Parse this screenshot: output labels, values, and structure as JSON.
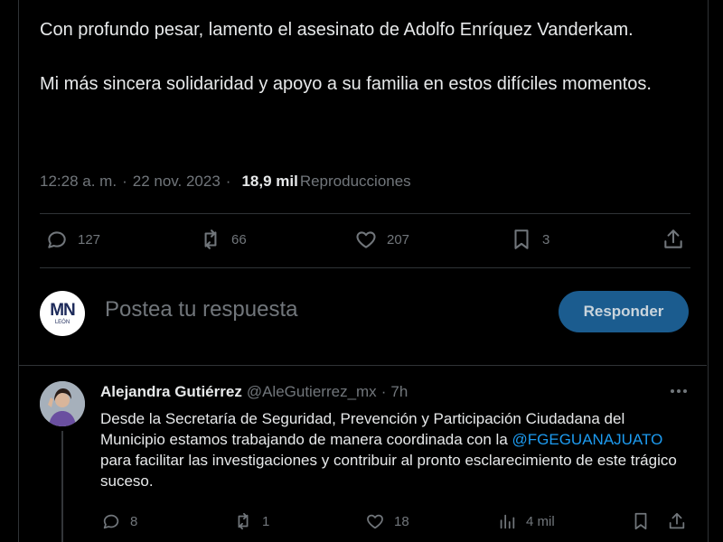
{
  "tweet": {
    "paragraph1": "Con profundo pesar, lamento el asesinato de Adolfo Enríquez Vanderkam.",
    "paragraph2": "Mi más sincera solidaridad y apoyo a su familia en estos difíciles momentos.",
    "time": "12:28 a. m.",
    "date": "22 nov. 2023",
    "views_count": "18,9 mil",
    "views_label": "Reproducciones",
    "separator": "·",
    "stats": {
      "replies": "127",
      "reposts": "66",
      "likes": "207",
      "bookmarks": "3"
    }
  },
  "composer": {
    "placeholder": "Postea tu respuesta",
    "button_label": "Responder",
    "avatar_text": "MN",
    "avatar_sub": "LEÓN"
  },
  "reply": {
    "name": "Alejandra Gutiérrez",
    "handle": "@AleGutierrez_mx",
    "age": "7h",
    "text_before": "Desde la Secretaría de Seguridad, Prevención y Participación Ciudadana del Municipio estamos trabajando de manera coordinada con la ",
    "mention": "@FGEGUANAJUATO",
    "text_after": " para facilitar las investigaciones y contribuir al pronto esclarecimiento de este trágico suceso.",
    "stats": {
      "replies": "8",
      "reposts": "1",
      "likes": "18",
      "views": "4 mil"
    }
  },
  "colors": {
    "background": "#000000",
    "text": "#e7e9ea",
    "muted": "#71767b",
    "accent": "#1d9bf0",
    "button": "#1b5c8f"
  },
  "icons": [
    "reply-icon",
    "repost-icon",
    "like-icon",
    "bookmark-icon",
    "share-icon",
    "views-icon",
    "more-icon"
  ]
}
